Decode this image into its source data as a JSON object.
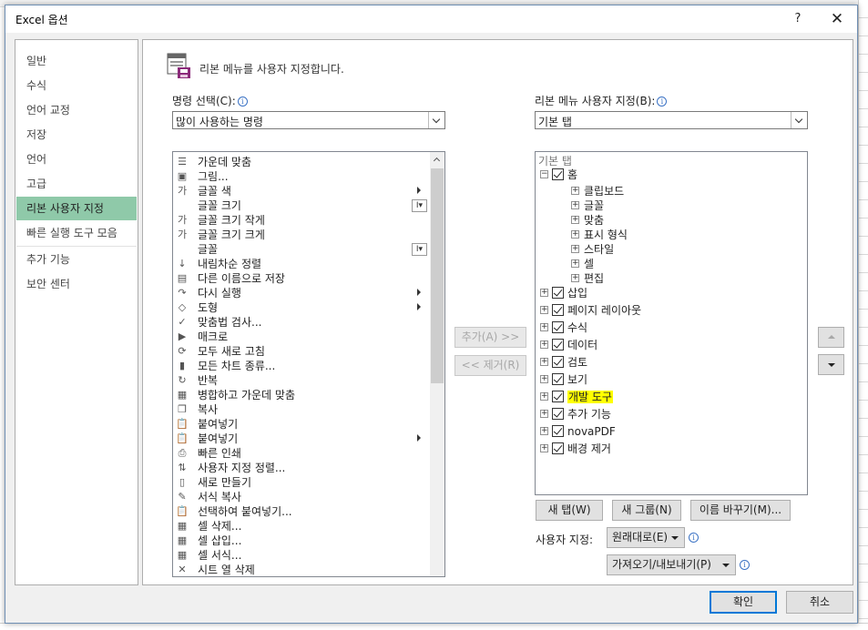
{
  "window": {
    "title": "Excel 옵션",
    "help": "?",
    "close": "✕"
  },
  "nav": [
    "일반",
    "수식",
    "언어 교정",
    "저장",
    "언어",
    "고급",
    "리본 사용자 지정",
    "빠른 실행 도구 모음",
    "추가 기능",
    "보안 센터"
  ],
  "nav_active": "리본 사용자 지정",
  "header": "리본 메뉴를 사용자 지정합니다.",
  "commands": {
    "label": "명령 선택(C):",
    "selected": "많이 사용하는 명령",
    "items": [
      {
        "label": "가운데 맞춤",
        "icon": "align-center-icon",
        "glyph": "☰"
      },
      {
        "label": "그림...",
        "icon": "picture-icon",
        "glyph": "▣"
      },
      {
        "label": "글꼴 색",
        "icon": "font-color-icon",
        "glyph": "가",
        "sub": true
      },
      {
        "label": "글꼴 크기",
        "icon": "font-size-icon",
        "glyph": "",
        "box": "I▾"
      },
      {
        "label": "글꼴 크기 작게",
        "icon": "decrease-font-icon",
        "glyph": "가"
      },
      {
        "label": "글꼴 크기 크게",
        "icon": "increase-font-icon",
        "glyph": "가"
      },
      {
        "label": "글꼴",
        "icon": "font-icon",
        "glyph": "",
        "box": "I▾"
      },
      {
        "label": "내림차순 정렬",
        "icon": "sort-desc-icon",
        "glyph": "↓"
      },
      {
        "label": "다른 이름으로 저장",
        "icon": "save-as-icon",
        "glyph": "▤"
      },
      {
        "label": "다시 실행",
        "icon": "redo-icon",
        "glyph": "↷",
        "sub": true
      },
      {
        "label": "도형",
        "icon": "shapes-icon",
        "glyph": "◇",
        "sub": true
      },
      {
        "label": "맞춤법 검사...",
        "icon": "spelling-icon",
        "glyph": "✓"
      },
      {
        "label": "매크로",
        "icon": "macro-icon",
        "glyph": "▶"
      },
      {
        "label": "모두 새로 고침",
        "icon": "refresh-all-icon",
        "glyph": "⟳"
      },
      {
        "label": "모든 차트 종류...",
        "icon": "chart-icon",
        "glyph": "▮"
      },
      {
        "label": "반복",
        "icon": "repeat-icon",
        "glyph": "↻"
      },
      {
        "label": "병합하고 가운데 맞춤",
        "icon": "merge-center-icon",
        "glyph": "▦"
      },
      {
        "label": "복사",
        "icon": "copy-icon",
        "glyph": "❐"
      },
      {
        "label": "붙여넣기",
        "icon": "paste-icon",
        "glyph": "📋"
      },
      {
        "label": "붙여넣기",
        "icon": "paste-icon",
        "glyph": "📋",
        "sub": true
      },
      {
        "label": "빠른 인쇄",
        "icon": "quick-print-icon",
        "glyph": "⎙"
      },
      {
        "label": "사용자 지정 정렬...",
        "icon": "custom-sort-icon",
        "glyph": "⇅"
      },
      {
        "label": "새로 만들기",
        "icon": "new-file-icon",
        "glyph": "▯"
      },
      {
        "label": "서식 복사",
        "icon": "format-painter-icon",
        "glyph": "✎"
      },
      {
        "label": "선택하여 붙여넣기...",
        "icon": "paste-special-icon",
        "glyph": "📋"
      },
      {
        "label": "셀 삭제...",
        "icon": "delete-cells-icon",
        "glyph": "▦"
      },
      {
        "label": "셀 삽입...",
        "icon": "insert-cells-icon",
        "glyph": "▦"
      },
      {
        "label": "셀 서식...",
        "icon": "format-cells-icon",
        "glyph": "▦"
      },
      {
        "label": "시트 열 삭제",
        "icon": "delete-column-icon",
        "glyph": "✕"
      }
    ]
  },
  "add_button": "추가(A) >>",
  "remove_button": "<< 제거(R)",
  "ribbon": {
    "label": "리본 메뉴 사용자 지정(B):",
    "selected": "기본 탭",
    "tree_header": "기본 탭",
    "home": {
      "label": "홈",
      "groups": [
        "클립보드",
        "글꼴",
        "맞춤",
        "표시 형식",
        "스타일",
        "셀",
        "편집"
      ]
    },
    "tabs": [
      "삽입",
      "페이지 레이아웃",
      "수식",
      "데이터",
      "검토",
      "보기",
      "개발 도구",
      "추가 기능",
      "novaPDF",
      "배경 제거"
    ],
    "highlighted": "개발 도구"
  },
  "new_tab_button": "새 탭(W)",
  "new_group_button": "새 그룹(N)",
  "rename_button": "이름 바꾸기(M)...",
  "customize": {
    "label": "사용자 지정:",
    "reset_button": "원래대로(E)",
    "import_export_button": "가져오기/내보내기(P)"
  },
  "ok_button": "확인",
  "cancel_button": "취소"
}
